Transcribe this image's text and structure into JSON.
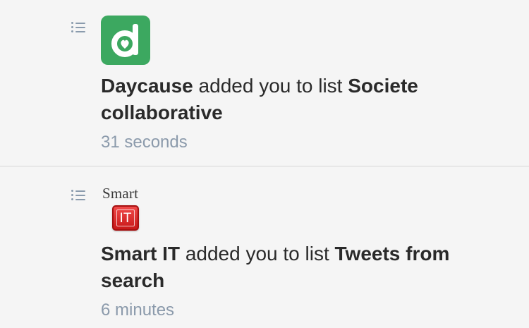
{
  "notifications": [
    {
      "actor": "Daycause",
      "action": "added you to list",
      "list_name": "Societe collaborative",
      "time": "31 seconds",
      "avatar_icon": "daycause-logo-icon",
      "avatar_color": "#3ca860"
    },
    {
      "actor": "Smart IT",
      "action": "added you to list",
      "list_name": "Tweets from search",
      "time": "6 minutes",
      "avatar_icon": "smart-it-logo-icon",
      "logo_word": "Smart",
      "logo_badge": "IT",
      "avatar_color": "#d42222"
    }
  ],
  "colors": {
    "text": "#2a2a2a",
    "timestamp": "#8b9aab",
    "list_icon": "#8a9bad",
    "divider": "#d6d6d6",
    "background": "#f5f5f5"
  }
}
